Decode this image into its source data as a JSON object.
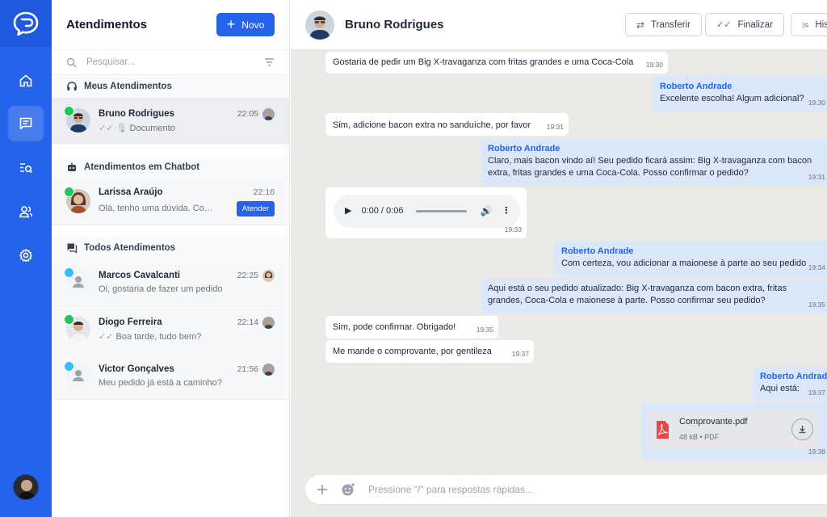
{
  "list": {
    "title": "Atendimentos",
    "new_label": "Novo",
    "search_placeholder": "Pesquisar...",
    "sections": {
      "mine": "Meus Atendimentos",
      "chatbot": "Atendimentos em Chatbot",
      "all": "Todos Atendimentos"
    },
    "conversations": [
      {
        "name": "Bruno Rodrigues",
        "time": "22:05",
        "preview": "Documento",
        "channel": "whatsapp"
      },
      {
        "name": "Larissa Araújo",
        "time": "22:16",
        "preview": "Olá, tenho uma dúvida. Como ...",
        "action": "Atender",
        "channel": "whatsapp"
      },
      {
        "name": "Marcos Cavalcanti",
        "time": "22:25",
        "preview": "Oi, gostaria de fazer um pedido",
        "channel": "web"
      },
      {
        "name": "Diogo Ferreira",
        "time": "22:14",
        "preview": "Boa tarde, tudo bem?",
        "channel": "whatsapp"
      },
      {
        "name": "Victor Gonçalves",
        "time": "21:56",
        "preview": "Meu pedido já está a caminho?",
        "channel": "web"
      }
    ]
  },
  "chat": {
    "contact_name": "Bruno Rodrigues",
    "buttons": {
      "transfer": "Transferir",
      "finish": "Finalizar",
      "history": "His"
    },
    "messages": [
      {
        "dir": "in",
        "text": "Gostaria de pedir um Big X-travaganza com fritas grandes e uma Coca-Cola",
        "time": "19:30"
      },
      {
        "dir": "out",
        "sender": "Roberto Andrade",
        "text": "Excelente escolha! Algum adicional?",
        "time": "19:30"
      },
      {
        "dir": "in",
        "text": "Sim, adicione bacon extra no sanduíche, por favor",
        "time": "19:31"
      },
      {
        "dir": "out",
        "sender": "Roberto Andrade",
        "text": "Claro, mais bacon vindo aí! Seu pedido ficará assim: Big X-travaganza com bacon extra, fritas grandes e uma Coca-Cola. Posso confirmar o pedido?",
        "time": "19:31"
      },
      {
        "dir": "in",
        "audio": "0:00 / 0:06",
        "time": "19:33"
      },
      {
        "dir": "out",
        "sender": "Roberto Andrade",
        "text": "Com certeza, vou adicionar a maionese à parte ao seu pedido",
        "time": "19:34"
      },
      {
        "dir": "out",
        "text": "Aqui está o seu pedido atualizado: Big X-travaganza com bacon extra, fritas grandes, Coca-Cola e maionese à parte. Posso confirmar seu pedido?",
        "time": "19:35"
      },
      {
        "dir": "in",
        "text": "Sim, pode confirmar. Obrigado!",
        "time": "19:35"
      },
      {
        "dir": "in",
        "text": "Me mande o comprovante, por gentileza",
        "time": "19:37"
      },
      {
        "dir": "out",
        "sender": "Roberto Andrade",
        "text": "Aqui está:",
        "time": "19:37"
      },
      {
        "dir": "out",
        "file_name": "Comprovante.pdf",
        "file_meta": "48 kB • PDF",
        "time": "19:38"
      }
    ],
    "composer_placeholder": "Pressione \"/\" para respostas rápidas..."
  },
  "colors": {
    "brand": "#2563eb",
    "whatsapp": "#22c55e",
    "web": "#38bdf8",
    "pdf": "#ef4444"
  }
}
